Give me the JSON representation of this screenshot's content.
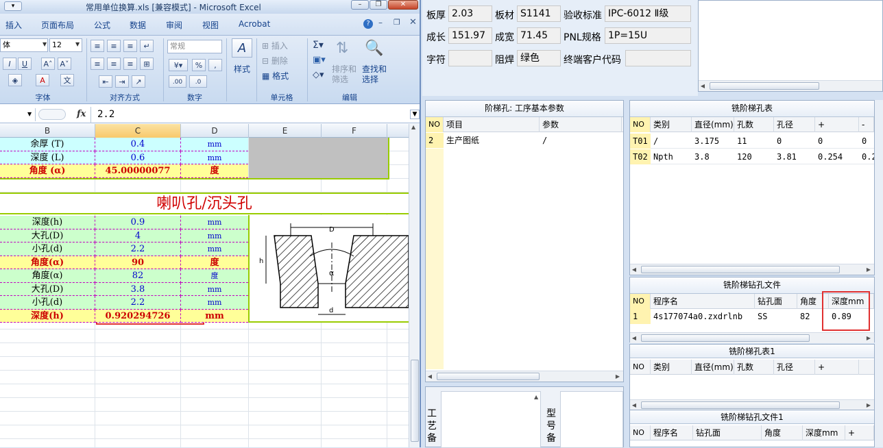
{
  "excel": {
    "title": "常用单位换算.xls  [兼容模式] - Microsoft Excel",
    "menu": [
      "插入",
      "页面布局",
      "公式",
      "数据",
      "审阅",
      "视图",
      "Acrobat"
    ],
    "ribbon": {
      "font_name": "体",
      "font_size": "12",
      "number_format": "常规",
      "groups": [
        "字体",
        "对齐方式",
        "数字",
        "样式",
        "单元格",
        "编辑"
      ],
      "cells_buttons": [
        "插入",
        "删除",
        "格式"
      ],
      "edit_buttons": [
        "排序和\n筛选",
        "查找和\n选择"
      ],
      "style_label": "样式"
    },
    "formula_value": "2.2",
    "fx": "fx",
    "columns": [
      "B",
      "C",
      "D",
      "E",
      "F"
    ],
    "section_title": "喇叭孔/沉头孔",
    "rows_top": [
      {
        "label": "余厚 (T)",
        "value": "0.4",
        "unit": "mm",
        "style": "cyan"
      },
      {
        "label": "深度 (L)",
        "value": "0.6",
        "unit": "mm",
        "style": "cyan"
      },
      {
        "label": "角度 (α)",
        "value": "45.00000077",
        "unit": "度",
        "style": "yellow"
      }
    ],
    "rows_bottom": [
      {
        "label": "深度(h)",
        "value": "0.9",
        "unit": "mm",
        "style": "green"
      },
      {
        "label": "大孔(D)",
        "value": "4",
        "unit": "mm",
        "style": "green"
      },
      {
        "label": "小孔(d)",
        "value": "2.2",
        "unit": "mm",
        "style": "green"
      },
      {
        "label": "角度(α)",
        "value": "90",
        "unit": "度",
        "style": "yellow"
      },
      {
        "label": "角度(α)",
        "value": "82",
        "unit": "度",
        "style": "green"
      },
      {
        "label": "大孔(D)",
        "value": "3.8",
        "unit": "mm",
        "style": "green"
      },
      {
        "label": "小孔(d)",
        "value": "2.2",
        "unit": "mm",
        "style": "green"
      },
      {
        "label": "深度(h)",
        "value": "0.920294726",
        "unit": "mm",
        "style": "yellow"
      }
    ],
    "diagram_labels": {
      "D": "D",
      "h": "h",
      "a": "α",
      "d": "d"
    }
  },
  "app": {
    "fields": {
      "banhou_label": "板厚",
      "banhou": "2.03",
      "bancai_label": "板材",
      "bancai": "S1141",
      "standard_label": "验收标准",
      "standard": "IPC-6012 Ⅱ级",
      "chengchang_label": "成长",
      "chengchang": "151.97",
      "chengkuan_label": "成宽",
      "chengkuan": "71.45",
      "pnl_label": "PNL规格",
      "pnl": "1P=15U",
      "zifu_label": "字符",
      "zifu": "",
      "zuhan_label": "阻焊",
      "zuhan": "绿色",
      "customer_label": "终端客户代码",
      "customer": ""
    },
    "step_params": {
      "title": "阶梯孔: 工序基本参数",
      "headers": [
        "NO",
        "项目",
        "参数"
      ],
      "rows": [
        [
          "2",
          "生产图纸",
          "/"
        ]
      ]
    },
    "milling_table": {
      "title": "铣阶梯孔表",
      "headers": [
        "NO",
        "类别",
        "直径(mm)",
        "孔数",
        "孔径",
        "+",
        "-"
      ],
      "rows": [
        [
          "T01",
          "/",
          "3.175",
          "11",
          "0",
          "0",
          "0"
        ],
        [
          "T02",
          "Npth",
          "3.8",
          "120",
          "3.81",
          "0.254",
          "0.2"
        ]
      ]
    },
    "drill_file": {
      "title": "铣阶梯钻孔文件",
      "headers": [
        "NO",
        "程序名",
        "钻孔面",
        "角度",
        "深度mm"
      ],
      "rows": [
        [
          "1",
          "4s177074a0.zxdrlnb",
          "SS",
          "82",
          "0.89"
        ]
      ]
    },
    "milling_table1": {
      "title": "铣阶梯孔表1",
      "headers": [
        "NO",
        "类别",
        "直径(mm)",
        "孔数",
        "孔径",
        "+"
      ]
    },
    "drill_file1": {
      "title": "铣阶梯钻孔文件1",
      "headers": [
        "NO",
        "程序名",
        "钻孔面",
        "角度",
        "深度mm",
        "+"
      ]
    },
    "process_note_label": "工艺备",
    "model_note_label": "型号备"
  }
}
